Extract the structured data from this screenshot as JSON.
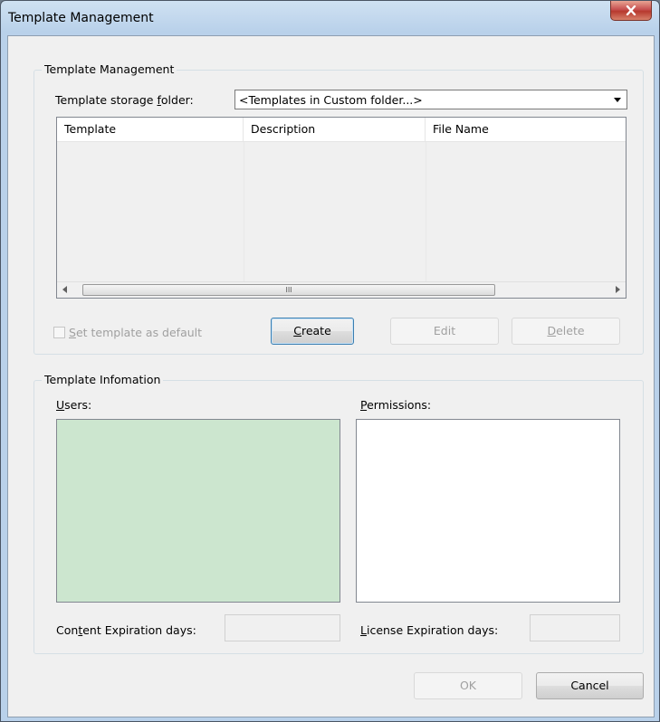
{
  "window": {
    "title": "Template Management",
    "close_icon": "close-icon"
  },
  "template_group": {
    "title": "Template Management",
    "folder_label": "Template storage folder:",
    "folder_label_pre": "Template storage ",
    "folder_label_u": "f",
    "folder_label_post": "older:",
    "folder_value": "<Templates in Custom folder...>",
    "columns": [
      "Template",
      "Description",
      "File Name"
    ],
    "scroll_thumb_glyph": "III",
    "default_checkbox": {
      "pre": "",
      "u": "S",
      "post": "et template as default",
      "checked": false
    },
    "buttons": {
      "create": {
        "u": "C",
        "post": "reate"
      },
      "edit": "Edit",
      "delete": {
        "u": "D",
        "post": "elete"
      }
    }
  },
  "info_group": {
    "title": "Template Infomation",
    "users": {
      "u": "U",
      "post": "sers:"
    },
    "permissions": {
      "u": "P",
      "post": "ermissions:"
    },
    "content_exp": {
      "pre": "Con",
      "u": "t",
      "post": "ent Expiration days:"
    },
    "license_exp": {
      "pre": "",
      "u": "L",
      "post": "icense Expiration days:"
    },
    "content_exp_value": "",
    "license_exp_value": ""
  },
  "footer": {
    "ok": "OK",
    "cancel": "Cancel"
  },
  "colors": {
    "users_bg": "#cce6cf",
    "permissions_bg": "#ffffff",
    "close_red": "#c75050"
  }
}
